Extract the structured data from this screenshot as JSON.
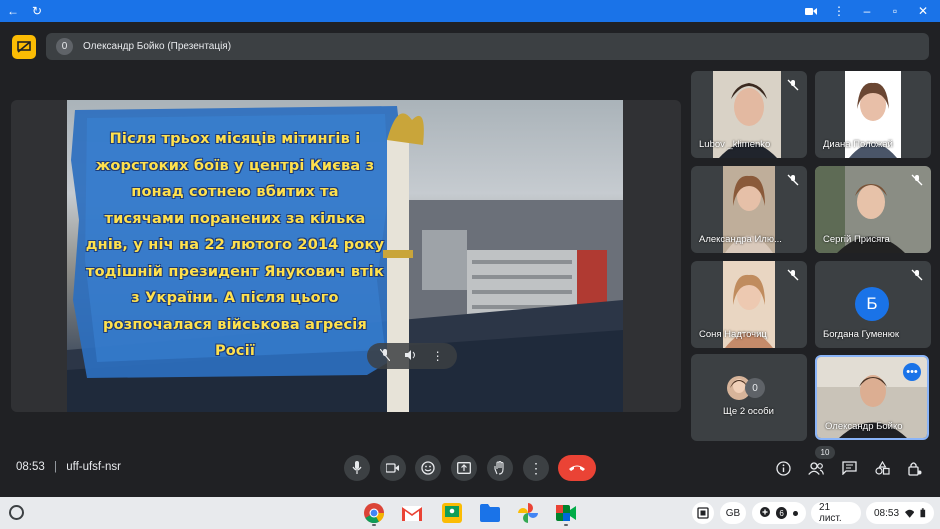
{
  "presenter": {
    "badge": "0",
    "label": "Олександр Бойко (Презентація)"
  },
  "slide": {
    "lines": [
      "Після трьох місяців мітингів і",
      "жорстоких боїв у центрі Києва з",
      "понад сотнею вбитих та",
      "тисячами поранених за кілька",
      "днів, у ніч на 22 лютого 2014 року",
      "тодішній президент Янукович втік",
      "з України. А після цього",
      "розпочалася військова агресія",
      "Росії"
    ]
  },
  "participants": [
    {
      "name": "Lubov _klimenko"
    },
    {
      "name": "Диана Положай"
    },
    {
      "name": "Александра Илю..."
    },
    {
      "name": "Сергій Присяга"
    },
    {
      "name": "Соня Надточиц"
    },
    {
      "name": "Богдана Гуменюк",
      "initial": "Б"
    },
    {
      "name": "Ще 2 особи",
      "badge": "0"
    },
    {
      "name": "Олександр Бойко"
    }
  ],
  "meeting": {
    "time": "08:53",
    "separator": "|",
    "code": "uff-ufsf-nsr",
    "people_count": "10"
  },
  "shelf": {
    "keyboard": "GB",
    "notifications": "6",
    "date": "21 лист.",
    "clock": "08:53"
  },
  "colors": {
    "topbar": "#1a73e8",
    "background": "#202124",
    "tile": "#3c4043",
    "hangup": "#ea4335",
    "accent_blue": "#1a73e8",
    "slide_text": "#ffe14d",
    "presenter_logo": "#fbbc04"
  }
}
